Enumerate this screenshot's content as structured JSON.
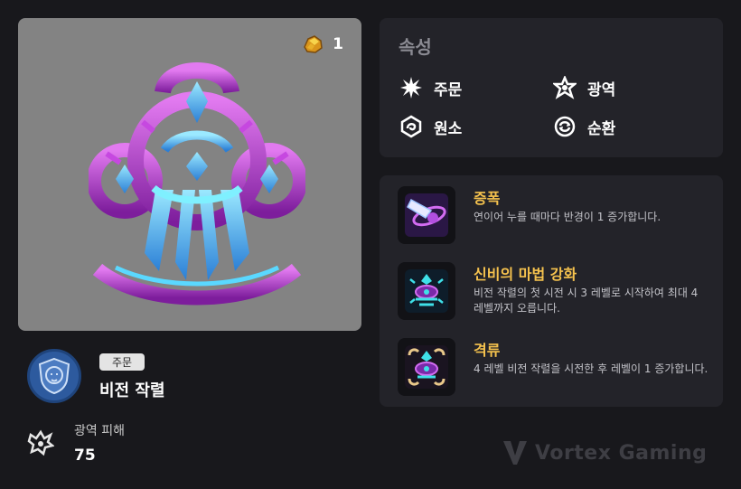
{
  "preview": {
    "cost_value": "1",
    "cost_icon": "gold-ore-icon"
  },
  "item": {
    "type_badge": "주문",
    "name": "비전 작렬",
    "avatar_icon": "lion-crest-icon"
  },
  "stat": {
    "label": "광역 피해",
    "value": "75",
    "icon": "area-damage-icon"
  },
  "attributes": {
    "title": "속성",
    "items": [
      {
        "label": "주문",
        "icon": "spell-burst-icon"
      },
      {
        "label": "광역",
        "icon": "area-star-icon"
      },
      {
        "label": "원소",
        "icon": "element-swirl-icon"
      },
      {
        "label": "순환",
        "icon": "cycle-icon"
      }
    ]
  },
  "effects": [
    {
      "title": "증폭",
      "desc": "연이어 누를 때마다 반경이 1 증가합니다.",
      "icon": "amplify-icon"
    },
    {
      "title": "신비의 마법 강화",
      "desc": "비전 작렬의 첫 시전 시 3 레벨로 시작하여 최대 4 레벨까지 오릅니다.",
      "icon": "arcane-boost-icon"
    },
    {
      "title": "격류",
      "desc": "4 레벨 비전 작렬을 시전한 후 레벨이 1 증가합니다.",
      "icon": "torrent-icon"
    }
  ],
  "watermark": {
    "text": "Vortex Gaming"
  },
  "colors": {
    "accent_title": "#f5c24e",
    "panel_bg": "#232329",
    "page_bg": "#18181c",
    "preview_bg": "#838383"
  }
}
